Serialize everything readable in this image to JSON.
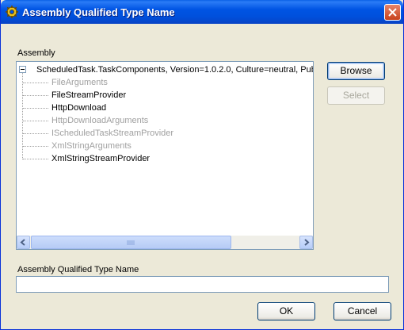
{
  "window": {
    "title": "Assembly Qualified Type Name"
  },
  "assembly_label": "Assembly",
  "tree": {
    "root": "ScheduledTask.TaskComponents, Version=1.0.2.0, Culture=neutral, Publi",
    "items": [
      {
        "label": "FileArguments",
        "enabled": false
      },
      {
        "label": "FileStreamProvider",
        "enabled": true
      },
      {
        "label": "HttpDownload",
        "enabled": true
      },
      {
        "label": "HttpDownloadArguments",
        "enabled": false
      },
      {
        "label": "IScheduledTaskStreamProvider",
        "enabled": false
      },
      {
        "label": "XmlStringArguments",
        "enabled": false
      },
      {
        "label": "XmlStringStreamProvider",
        "enabled": true
      }
    ]
  },
  "buttons": {
    "browse": "Browse",
    "select": "Select",
    "ok": "OK",
    "cancel": "Cancel"
  },
  "type_name_label": "Assembly Qualified Type Name",
  "type_name_value": "",
  "icons": {
    "app": "gear-icon",
    "close": "close-icon",
    "collapse": "minus-icon",
    "scroll_left": "arrow-left-icon",
    "scroll_right": "arrow-right-icon"
  },
  "colors": {
    "title_bar": "#0054e3",
    "dialog_bg": "#ece9d8",
    "disabled_text": "#a0a0a0",
    "close_button": "#c8421c"
  }
}
